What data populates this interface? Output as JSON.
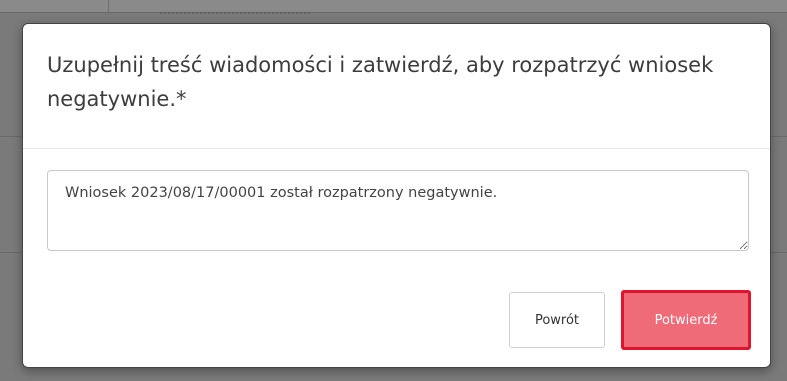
{
  "dialog": {
    "title": "Uzupełnij treść wiadomości i zatwierdź, aby rozpatrzyć wniosek negatywnie.*",
    "message_value": "Wniosek 2023/08/17/00001 został rozpatrzony negatywnie.",
    "back_label": "Powrót",
    "confirm_label": "Potwierdź"
  },
  "colors": {
    "confirm_background": "#ef6b78",
    "confirm_border": "#e0142b",
    "backdrop": "#7a7a7a"
  }
}
